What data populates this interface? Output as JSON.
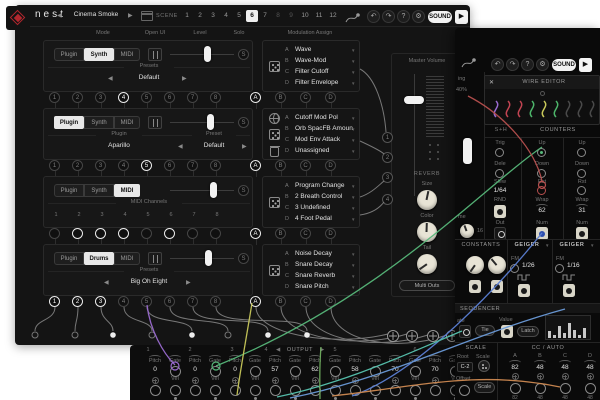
{
  "ui": {
    "prev": "◀",
    "next": "▶",
    "caret": "▼"
  },
  "colors": {
    "accent": "#b3272e",
    "purple": "#9a6bd0",
    "green": "#57b87a",
    "red": "#b8504f",
    "blue": "#5b7fd4",
    "blue2": "#6b9bd9",
    "yellow": "#c9c95a",
    "orange": "#cf8a52",
    "teal": "#57c4b0",
    "green2": "#6fae5f"
  },
  "header": {
    "logo": "nest",
    "title": "Cinema Smoke",
    "scene_label": "SCENE",
    "scenes": [
      "1",
      "2",
      "3",
      "4",
      "5",
      "6",
      "7",
      "8",
      "9",
      "10",
      "11",
      "12"
    ],
    "undo": "↶",
    "redo": "↷",
    "help": "?",
    "gear": "⚙",
    "sound": "SOUND",
    "play": "▶"
  },
  "columns": {
    "mode": "Mode",
    "open_ui": "Open UI",
    "level": "Level",
    "solo": "Solo",
    "assign": "Modulation Assign"
  },
  "slots": [
    "A",
    "B",
    "C",
    "D"
  ],
  "modules": [
    {
      "buttons": [
        "Plugin",
        "Synth",
        "MIDI"
      ],
      "solo": "S",
      "label": "Presets",
      "value": "Default",
      "sockets": [
        "1",
        "2",
        "3",
        "4",
        "5",
        "6",
        "7",
        "8"
      ],
      "assign": [
        {
          "slot": "A",
          "name": "Wave"
        },
        {
          "slot": "B",
          "name": "Wave-Mod"
        },
        {
          "slot": "C",
          "name": "Filter Cutoff"
        },
        {
          "slot": "D",
          "name": "Filter Envelope"
        }
      ]
    },
    {
      "buttons": [
        "Plugin",
        "Synth",
        "MIDI"
      ],
      "solo": "S",
      "label": "Plugin",
      "value": "Aparillo",
      "label2": "Preset",
      "value2": "Default",
      "sockets": [
        "1",
        "2",
        "3",
        "4",
        "5",
        "6",
        "7",
        "8"
      ],
      "assign": [
        {
          "slot": "A",
          "name": "Cutoff Mod Pol"
        },
        {
          "slot": "B",
          "name": "Orb SpacFB Amoun"
        },
        {
          "slot": "C",
          "name": "Mod Env Attack"
        },
        {
          "slot": "D",
          "name": "Unassigned"
        }
      ]
    },
    {
      "buttons": [
        "Plugin",
        "Synth",
        "MIDI"
      ],
      "solo": "S",
      "label": "MIDI Channels",
      "sockets": [
        "1",
        "2",
        "3",
        "4",
        "5",
        "6",
        "7",
        "8"
      ],
      "assign": [
        {
          "slot": "A",
          "name": "Program Change"
        },
        {
          "slot": "B",
          "name": "2 Breath Control"
        },
        {
          "slot": "C",
          "name": "3 Undefined"
        },
        {
          "slot": "D",
          "name": "4 Foot Pedal"
        }
      ]
    },
    {
      "buttons": [
        "Plugin",
        "Drums",
        "MIDI"
      ],
      "solo": "S",
      "label": "Presets",
      "value": "Big Oh Eight",
      "sockets": [
        "1",
        "2",
        "3",
        "4",
        "5",
        "6",
        "7",
        "8"
      ],
      "assign": [
        {
          "slot": "A",
          "name": "Noise Decay"
        },
        {
          "slot": "B",
          "name": "Snare Decay"
        },
        {
          "slot": "C",
          "name": "Snare Reverb"
        },
        {
          "slot": "D",
          "name": "Snare Pitch"
        }
      ]
    }
  ],
  "master": {
    "volume": "Master Volume",
    "reverb": "REVERB",
    "size": "Size",
    "color": "Color",
    "tail": "Tail",
    "multi": "Multi Outs",
    "outs": [
      "1",
      "2",
      "3",
      "4"
    ]
  },
  "rw": {
    "close": "✕",
    "wire_editor": "WIRE EDITOR",
    "undo": "↶",
    "redo": "↷",
    "help": "?",
    "gear": "⚙",
    "sound": "SOUND",
    "play": "▶",
    "frags": {
      "a": "ing",
      "b": "40%",
      "c": "me",
      "d": "16"
    },
    "swatches": [
      "#9a6bd0",
      "#c24452",
      "#c24452",
      "#4db56a",
      "#c9c95a",
      "#4db56a",
      "#4a4a4a",
      "#4a4a4a",
      "#4a4a4a"
    ],
    "sh": {
      "title": "S+H",
      "trig": "Trig",
      "dele": "Dele",
      "slew": "Slew",
      "slew_val": "1/64",
      "rnd": "RND",
      "out": "Out"
    },
    "counters": {
      "title": "COUNTERS",
      "up": "Up",
      "down": "Down",
      "rst": "Rst",
      "wrap": "Wrap",
      "num": "Num",
      "wrap1": "62",
      "wrap2": "31"
    },
    "constants": {
      "title": "CONSTANTS"
    },
    "geiger": {
      "name": "GEIGER",
      "fm": "FM",
      "rate1": "1/26",
      "rate2": "1/16"
    },
    "seq": {
      "title": "SEQUENCER",
      "rate": "ate",
      "tie": "Tie",
      "value": "Value",
      "latch": "Latch",
      "bars": [
        7,
        3,
        12,
        5,
        15,
        8,
        3,
        10
      ]
    },
    "scale": {
      "title": "SCALE",
      "root": "Root",
      "scale": "Scale",
      "root_val": "C-2",
      "offset": "Offset",
      "scale_btn": "Scale"
    },
    "cc": {
      "title": "CC / AUTO",
      "cols": [
        {
          "l": "A",
          "v": "82",
          "s": "82"
        },
        {
          "l": "B",
          "v": "48",
          "s": "48"
        },
        {
          "l": "C",
          "v": "48",
          "s": "48"
        },
        {
          "l": "D",
          "v": "48",
          "s": "48"
        }
      ]
    }
  },
  "strip": {
    "title": "OUTPUT",
    "nums": [
      "1",
      "2",
      "3",
      "4",
      "5",
      "6"
    ],
    "pitch": "Pitch",
    "gate": "Gate",
    "vel": "Vel",
    "values": [
      "0",
      "0",
      "0",
      "57",
      "62",
      "58",
      "70",
      "70"
    ]
  }
}
